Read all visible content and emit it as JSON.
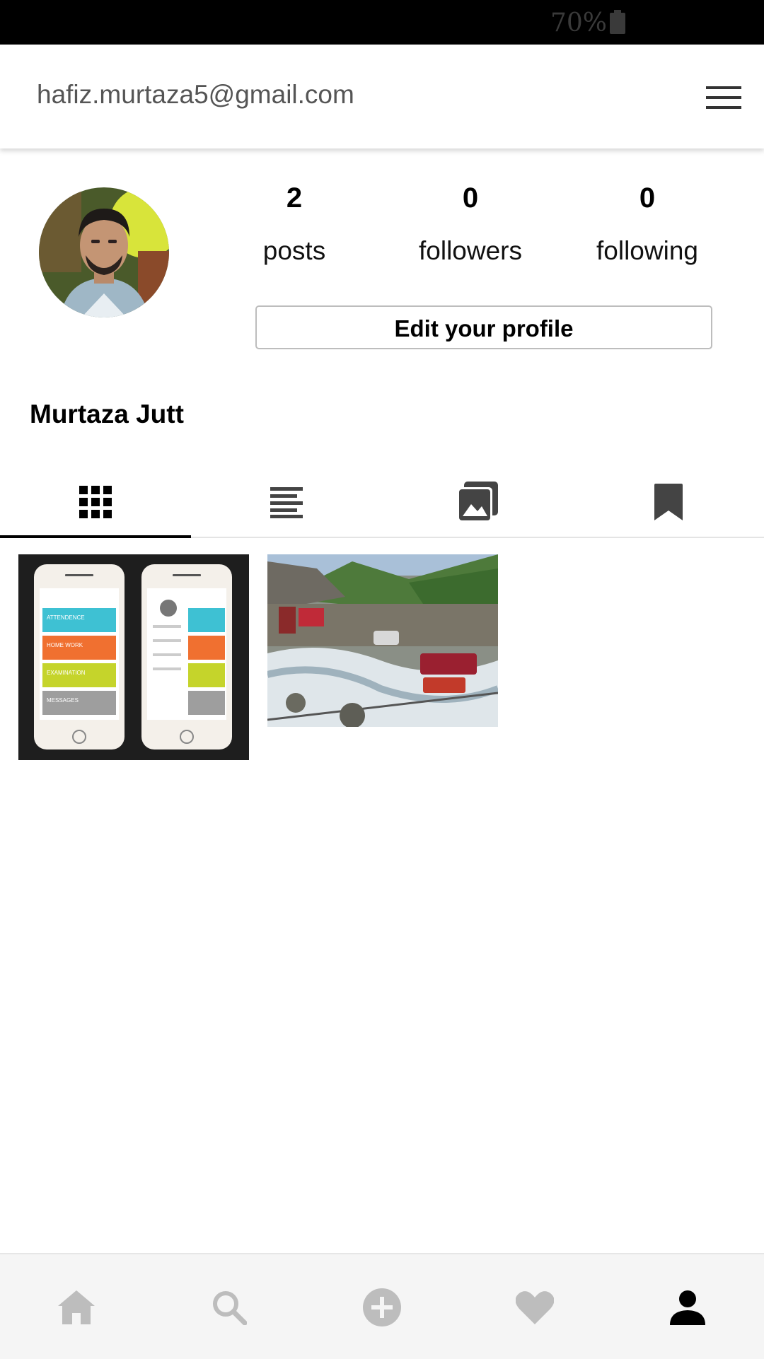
{
  "status_bar": {
    "battery": "70%"
  },
  "app_bar": {
    "email": "hafiz.murtaza5@gmail.com",
    "menu_icon": "hamburger-menu-icon"
  },
  "profile": {
    "name": "Murtaza Jutt",
    "stats": [
      {
        "count": "2",
        "label": "posts"
      },
      {
        "count": "0",
        "label": "followers"
      },
      {
        "count": "0",
        "label": "following"
      }
    ],
    "edit_button": "Edit your profile"
  },
  "tabs": [
    {
      "icon": "grid-icon",
      "active": true
    },
    {
      "icon": "list-icon",
      "active": false
    },
    {
      "icon": "photos-icon",
      "active": false
    },
    {
      "icon": "bookmark-icon",
      "active": false
    }
  ],
  "posts_thumb1": {
    "labels": [
      "ATTENDENCE",
      "HOME WORK",
      "EXAMINATION",
      "MESSAGES"
    ],
    "colors": [
      "#3ec1d3",
      "#f07030",
      "#c5d42b",
      "#9e9e9e"
    ]
  },
  "bottom_nav": [
    {
      "icon": "home-icon",
      "active": false
    },
    {
      "icon": "search-icon",
      "active": false
    },
    {
      "icon": "add-circle-icon",
      "active": false
    },
    {
      "icon": "heart-icon",
      "active": false
    },
    {
      "icon": "person-icon",
      "active": true
    }
  ],
  "colors": {
    "active": "#000000",
    "inactive": "#bdbdbd",
    "tab_icon": "#444444"
  }
}
